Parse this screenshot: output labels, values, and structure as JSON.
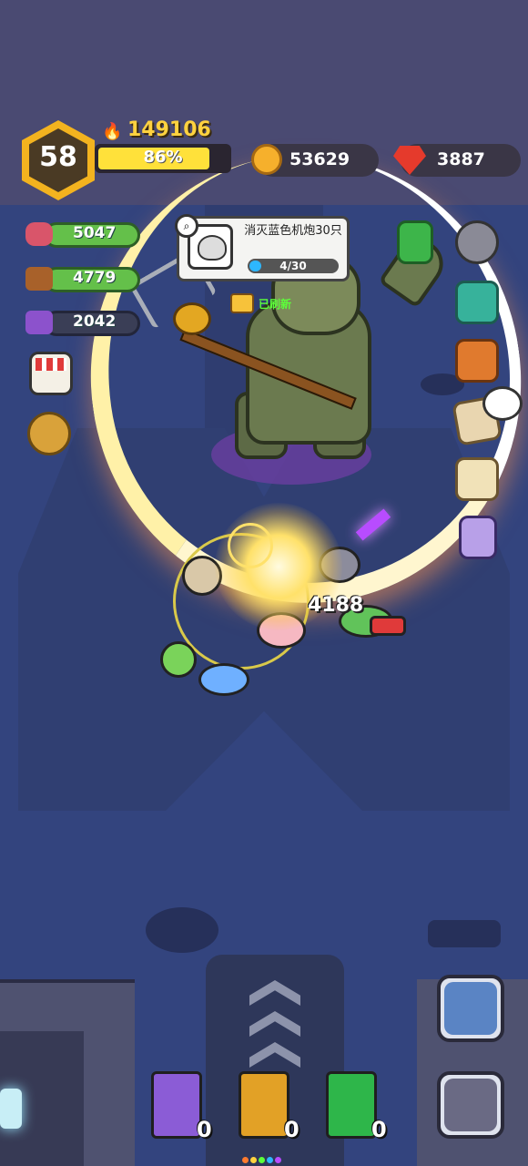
{
  "hud": {
    "level": "58",
    "power": "149106",
    "xp_percent_label": "86%",
    "xp_fraction": 0.86,
    "coins": "53629",
    "gems": "3887"
  },
  "resources": {
    "meat": "5047",
    "wood": "4779",
    "ore": "2042"
  },
  "quest": {
    "title": "消灭蓝色机炮30只",
    "progress_label": "4/30",
    "progress_fraction": 0.133,
    "refreshed_label": "已刷新"
  },
  "combat": {
    "damage_number": "4188"
  },
  "skill_books": [
    {
      "icon": "purple-lightning-book-icon",
      "count": "0",
      "color": "#8b5cd6"
    },
    {
      "icon": "gold-feather-book-icon",
      "count": "0",
      "color": "#e2a126"
    },
    {
      "icon": "green-cross-book-icon",
      "count": "0",
      "color": "#2eb64a"
    }
  ],
  "colors": {
    "accent_gold": "#ffd23f",
    "xp_bar": "#ffe13a",
    "quest_bar": "#2db7ff",
    "resource_bar": "#64c04a"
  }
}
